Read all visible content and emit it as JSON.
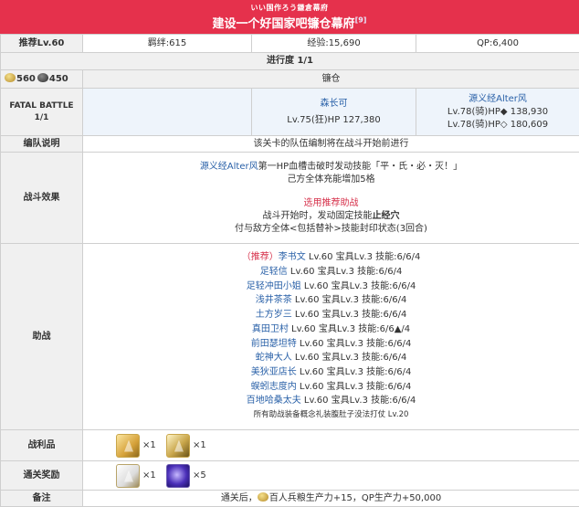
{
  "header": {
    "subtitle": "いい国作ろう鎌倉幕府",
    "title": "建设一个好国家吧镰仓幕府",
    "title_mark": "[9]",
    "bg_color": "#e5314c"
  },
  "stats": {
    "recommend": "推荐Lv.60",
    "bond": "羁绊:615",
    "exp": "经验:15,690",
    "qp": "QP:6,400"
  },
  "progress": "进行度 1/1",
  "wave": {
    "ap_gold": "560",
    "ap_dark": "450",
    "location": "镰仓"
  },
  "fatal": {
    "label_line1": "FATAL BATTLE",
    "label_line2": "1/1",
    "enemy1_name": "森长可",
    "enemy1_stats": "Lv.75(狂)HP 127,380",
    "enemy2_name": "源义经Alter风",
    "enemy2_line1": "Lv.78(骑)HP◆ 138,930",
    "enemy2_line2": "Lv.78(骑)HP◇ 180,609"
  },
  "formation": {
    "label": "编队说明",
    "text": "该关卡的队伍编制将在战斗开始前进行"
  },
  "effect": {
    "label": "战斗效果",
    "l1_name": "源义经Alter风",
    "l1_text": "第一HP血槽击破时发动技能「平・氏・必・灭！」",
    "l2": "己方全体充能增加5格",
    "l3": "选用推荐助战",
    "l4_a": "战斗开始时，发动固定技能",
    "l4_b": "止经穴",
    "l5": "付与敌方全体<包括替补>技能封印状态(3回合)"
  },
  "support": {
    "label": "助战",
    "rows": [
      {
        "prefix": "（推荐）",
        "name": "李书文",
        "stats": " Lv.60 宝具Lv.3 技能:6/6/4"
      },
      {
        "prefix": "",
        "name": "足轻信",
        "stats": " Lv.60 宝具Lv.3 技能:6/6/4"
      },
      {
        "prefix": "",
        "name": "足轻冲田小姐",
        "stats": " Lv.60 宝具Lv.3 技能:6/6/4"
      },
      {
        "prefix": "",
        "name": "浅井茶茶",
        "stats": " Lv.60 宝具Lv.3 技能:6/6/4"
      },
      {
        "prefix": "",
        "name": "土方岁三",
        "stats": " Lv.60 宝具Lv.3 技能:6/6/4"
      },
      {
        "prefix": "",
        "name": "真田卫村",
        "stats": " Lv.60 宝具Lv.3 技能:6/6▲/4"
      },
      {
        "prefix": "",
        "name": "前田瑟坦特",
        "stats": " Lv.60 宝具Lv.3 技能:6/6/4"
      },
      {
        "prefix": "",
        "name": "蛇神大人",
        "stats": " Lv.60 宝具Lv.3 技能:6/6/4"
      },
      {
        "prefix": "",
        "name": "美狄亚店长",
        "stats": " Lv.60 宝具Lv.3 技能:6/6/4"
      },
      {
        "prefix": "",
        "name": "蜈蚓志度内",
        "stats": " Lv.60 宝具Lv.3 技能:6/6/4"
      },
      {
        "prefix": "",
        "name": "百地哈桑太夫",
        "stats": " Lv.60 宝具Lv.3 技能:6/6/4"
      }
    ],
    "footer": "所有助战装备概念礼装腹肚子没法打仗 Lv.20"
  },
  "loot": {
    "label": "战利品",
    "item1_icon": "gold-gem-icon",
    "item1_count": "×1",
    "item2_icon": "gold-pyramid-icon",
    "item2_count": "×1"
  },
  "clear": {
    "label": "通关奖励",
    "item1_icon": "white-relic-icon",
    "item1_count": "×1",
    "item2_icon": "purple-orb-icon",
    "item2_count": "×5"
  },
  "note": {
    "label": "备注",
    "text_a": "通关后，",
    "text_b": "百人兵粮生产力+15，QP生产力+50,000"
  },
  "colors": {
    "accent_red": "#d6304a",
    "link_blue": "#2a61a8",
    "label_gray": "#f0f0f0"
  }
}
